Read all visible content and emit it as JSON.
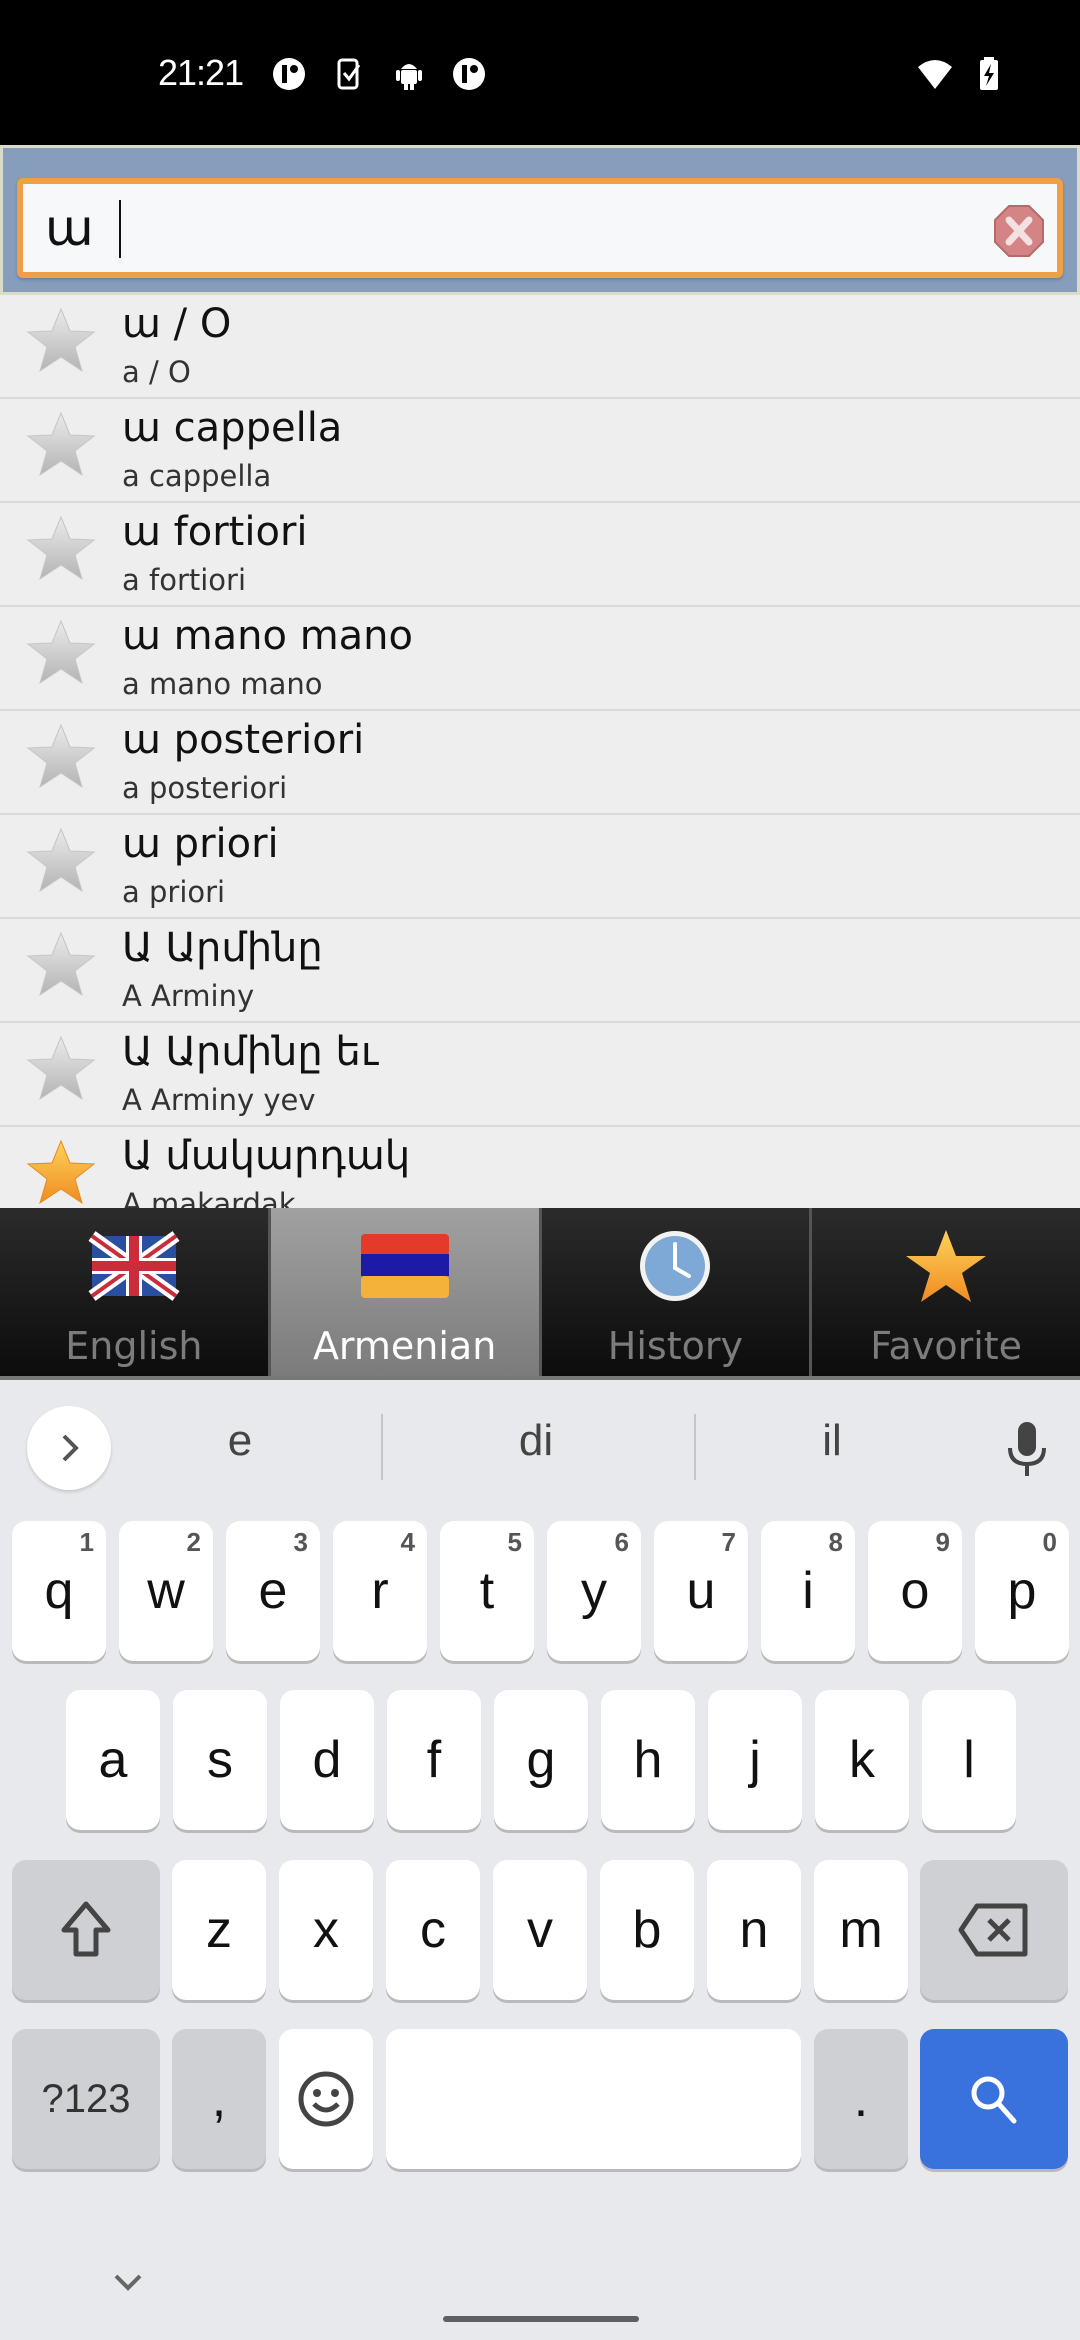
{
  "status_bar": {
    "time": "21:21",
    "left_icons": [
      "notification-app-icon",
      "device-check-icon",
      "android-icon",
      "notification-app-icon"
    ],
    "right_icons": [
      "wifi-icon",
      "battery-charging-icon"
    ]
  },
  "search": {
    "value": "ա",
    "placeholder": "",
    "clear_icon": "clear-icon"
  },
  "results": [
    {
      "word": "ա / O",
      "translit": "a / O",
      "favorite": false
    },
    {
      "word": "ա cappella",
      "translit": "a cappella",
      "favorite": false
    },
    {
      "word": "ա fortiori",
      "translit": "a fortiori",
      "favorite": false
    },
    {
      "word": "ա mano mano",
      "translit": "a mano mano",
      "favorite": false
    },
    {
      "word": "ա posteriori",
      "translit": "a posteriori",
      "favorite": false
    },
    {
      "word": "ա priori",
      "translit": "a priori",
      "favorite": false
    },
    {
      "word": "Ա Արմինը",
      "translit": "A Arminy",
      "favorite": false
    },
    {
      "word": "Ա Արմինը եւ",
      "translit": "A Arminy yev",
      "favorite": false
    },
    {
      "word": "Ա մակարդակ",
      "translit": "A makardak",
      "favorite": true
    }
  ],
  "tabs": [
    {
      "label": "English",
      "icon": "uk-flag-icon",
      "active": false
    },
    {
      "label": "Armenian",
      "icon": "armenia-flag-icon",
      "active": true
    },
    {
      "label": "History",
      "icon": "clock-icon",
      "active": false
    },
    {
      "label": "Favorite",
      "icon": "star-icon",
      "active": false
    }
  ],
  "keyboard": {
    "suggestions": [
      "e",
      "di",
      "il"
    ],
    "row1": [
      {
        "key": "q",
        "hint": "1"
      },
      {
        "key": "w",
        "hint": "2"
      },
      {
        "key": "e",
        "hint": "3"
      },
      {
        "key": "r",
        "hint": "4"
      },
      {
        "key": "t",
        "hint": "5"
      },
      {
        "key": "y",
        "hint": "6"
      },
      {
        "key": "u",
        "hint": "7"
      },
      {
        "key": "i",
        "hint": "8"
      },
      {
        "key": "o",
        "hint": "9"
      },
      {
        "key": "p",
        "hint": "0"
      }
    ],
    "row2": [
      "a",
      "s",
      "d",
      "f",
      "g",
      "h",
      "j",
      "k",
      "l"
    ],
    "row3": [
      "z",
      "x",
      "c",
      "v",
      "b",
      "n",
      "m"
    ],
    "symbols_label": "?123",
    "comma_label": ",",
    "period_label": "."
  },
  "colors": {
    "search_border": "#f0a044",
    "search_panel": "#869dbc",
    "active_tab": "#8e8e8e",
    "enter_key": "#3a72dd",
    "favorite_star": "#f5a623"
  }
}
